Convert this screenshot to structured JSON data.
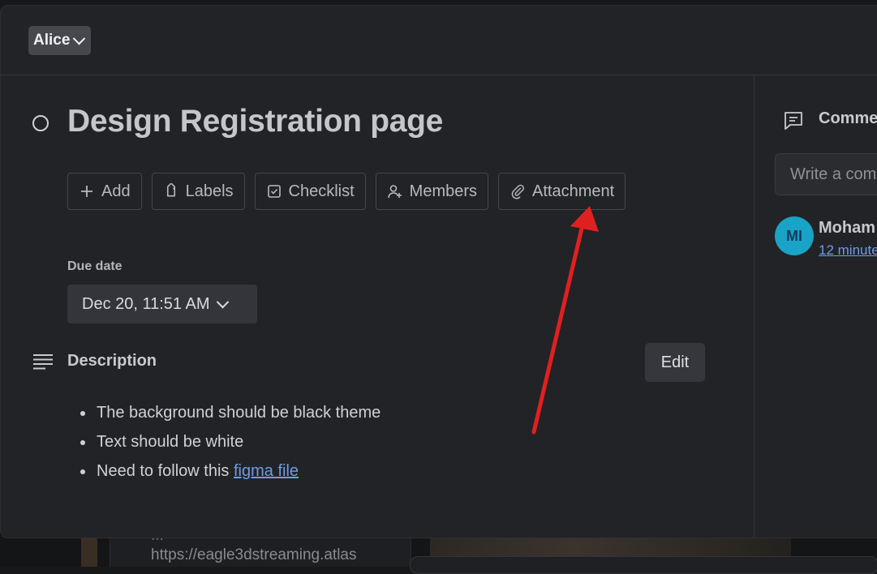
{
  "background": {
    "url_text": "https://eagle3dstreaming.atlas",
    "partial_text": "..."
  },
  "header": {
    "user_select_label": "Alice"
  },
  "card": {
    "title": "Design Registration page",
    "actions": [
      {
        "label": "Add",
        "icon": "plus-icon"
      },
      {
        "label": "Labels",
        "icon": "tag-icon"
      },
      {
        "label": "Checklist",
        "icon": "checkbox-icon"
      },
      {
        "label": "Members",
        "icon": "user-add-icon"
      },
      {
        "label": "Attachment",
        "icon": "paperclip-icon"
      }
    ],
    "due_date": {
      "label": "Due date",
      "value": "Dec 20, 11:51 AM"
    },
    "description": {
      "label": "Description",
      "edit_label": "Edit",
      "items": [
        {
          "text": "The background should be black theme"
        },
        {
          "text": "Text should be white"
        },
        {
          "text": "Need to follow this ",
          "link": "figma file"
        }
      ]
    }
  },
  "comments": {
    "title": "Comme",
    "input_placeholder": "Write a com",
    "items": [
      {
        "initials": "MI",
        "author": "Moham",
        "time": "12 minute"
      }
    ]
  },
  "colors": {
    "accent": "#6e9ce6",
    "annotation_arrow": "#e02020",
    "avatar_bg": "#19a3c6"
  }
}
